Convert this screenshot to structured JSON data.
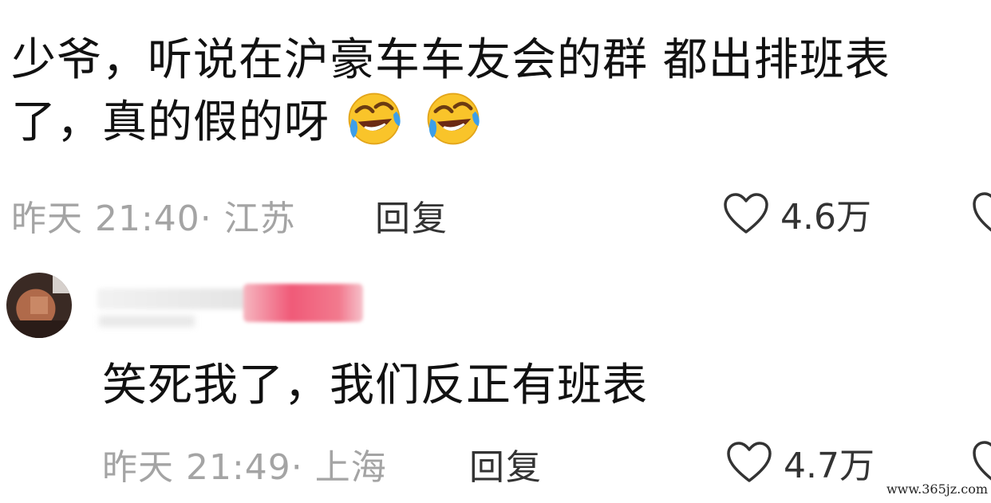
{
  "comments": [
    {
      "text_line1": "少爷，听说在沪豪车车友会的群 都出排班表",
      "text_line2": "了，真的假的呀",
      "emojis": [
        "laughing-crying-emoji",
        "laughing-crying-emoji"
      ],
      "time": "昨天 21:40",
      "location": "· 江苏",
      "reply_label": "回复",
      "likes": "4.6万"
    },
    {
      "text": "笑死我了，我们反正有班表",
      "time": "昨天 21:49",
      "location": "· 上海",
      "reply_label": "回复",
      "likes": "4.7万"
    }
  ],
  "watermark": "www.365jz.com",
  "colors": {
    "meta": "#a4a4a4",
    "text": "#111111",
    "emoji_face": "#f9c42a",
    "tears": "#3d9fe8"
  }
}
